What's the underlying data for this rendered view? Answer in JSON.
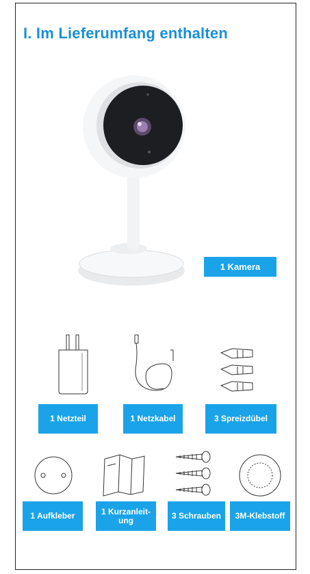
{
  "header": {
    "title": "I. Im Lieferumfang enthalten"
  },
  "items": {
    "camera": "1 Kamera",
    "adapter": "1 Netzteil",
    "cable": "1 Netzkabel",
    "anchors": "3 Spreizdübel",
    "sticker": "1 Aufkleber",
    "manual_line1": "1 Kurzanleit-",
    "manual_line2": "ung",
    "screws": "3 Schrauben",
    "adhesive": "3M-Klebstoff"
  },
  "colors": {
    "accent": "#1aa3e8",
    "title": "#1a8fd8"
  }
}
